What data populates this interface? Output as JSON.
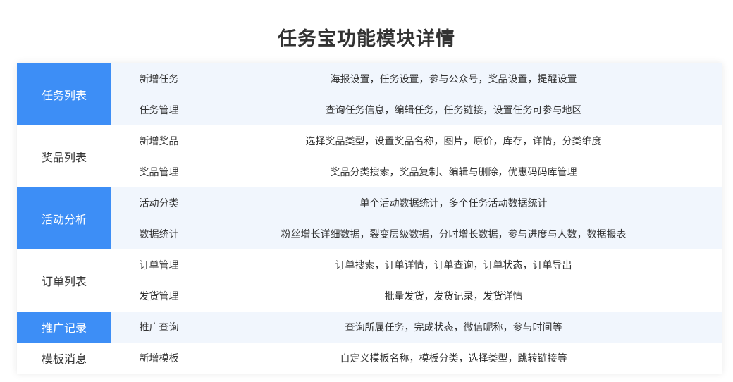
{
  "page": {
    "title": "任务宝功能模块详情"
  },
  "colors": {
    "accent": "#3d8ef6",
    "shaded_row": "#f1f6fd",
    "text": "#333333"
  },
  "modules": [
    {
      "name": "任务列表",
      "rows": [
        {
          "feature": "新增任务",
          "description": "海报设置，任务设置，参与公众号，奖品设置，提醒设置"
        },
        {
          "feature": "任务管理",
          "description": "查询任务信息，编辑任务，任务链接，设置任务可参与地区"
        }
      ]
    },
    {
      "name": "奖品列表",
      "rows": [
        {
          "feature": "新增奖品",
          "description": "选择奖品类型，设置奖品名称，图片，原价，库存，详情，分类维度"
        },
        {
          "feature": "奖品管理",
          "description": "奖品分类搜索，奖品复制、编辑与删除，优惠码码库管理"
        }
      ]
    },
    {
      "name": "活动分析",
      "rows": [
        {
          "feature": "活动分类",
          "description": "单个活动数据统计，多个任务活动数据统计"
        },
        {
          "feature": "数据统计",
          "description": "粉丝增长详细数据，裂变层级数据，分时增长数据，参与进度与人数，数据报表"
        }
      ]
    },
    {
      "name": "订单列表",
      "rows": [
        {
          "feature": "订单管理",
          "description": "订单搜索，订单详情，订单查询，订单状态，订单导出"
        },
        {
          "feature": "发货管理",
          "description": "批量发货，发货记录，发货详情"
        }
      ]
    },
    {
      "name": "推广记录",
      "rows": [
        {
          "feature": "推广查询",
          "description": "查询所属任务，完成状态，微信昵称，参与时间等"
        }
      ]
    },
    {
      "name": "模板消息",
      "rows": [
        {
          "feature": "新增模板",
          "description": "自定义模板名称，模板分类，选择类型，跳转链接等"
        }
      ]
    }
  ]
}
